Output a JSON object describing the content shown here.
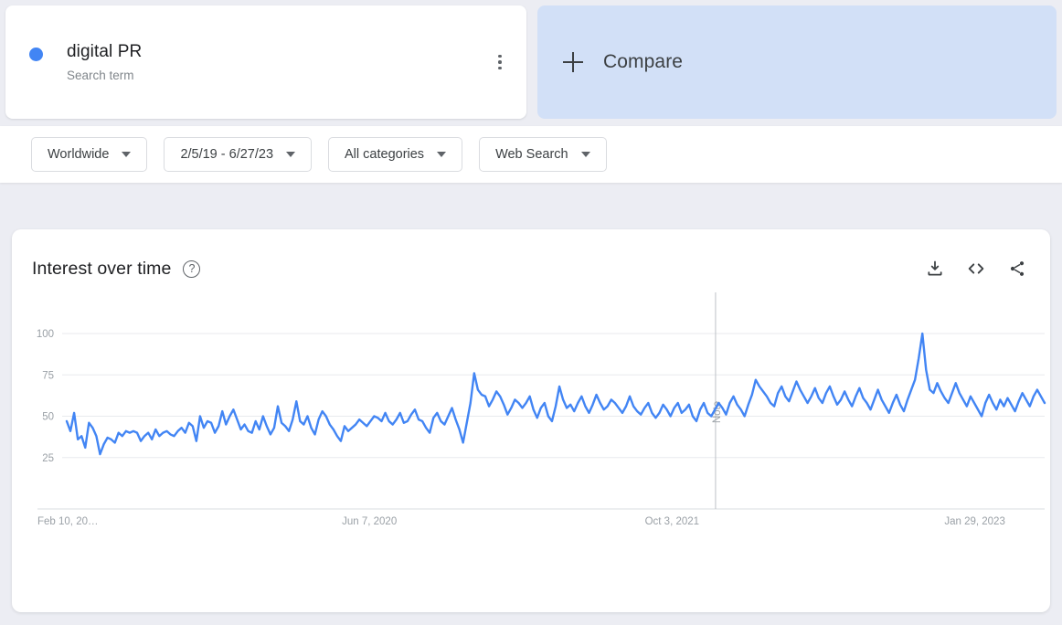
{
  "term": {
    "name": "digital PR",
    "type_label": "Search term",
    "dot_color": "#4285f4",
    "menu_icon": "more-vert-icon"
  },
  "compare": {
    "label": "Compare",
    "icon": "plus-icon"
  },
  "filters": [
    {
      "name": "location",
      "label": "Worldwide"
    },
    {
      "name": "time-range",
      "label": "2/5/19 - 6/27/23"
    },
    {
      "name": "category",
      "label": "All categories"
    },
    {
      "name": "search-type",
      "label": "Web Search"
    }
  ],
  "chart_card": {
    "title": "Interest over time",
    "help_icon": "question-mark-icon",
    "actions": [
      {
        "name": "download-icon",
        "label": "Download"
      },
      {
        "name": "embed-code-icon",
        "label": "Embed"
      },
      {
        "name": "share-icon",
        "label": "Share"
      }
    ]
  },
  "chart_data": {
    "type": "line",
    "title": "Interest over time",
    "xlabel": "",
    "ylabel": "",
    "ylim": [
      0,
      100
    ],
    "yticks": [
      25,
      50,
      75,
      100
    ],
    "grid": true,
    "legend": "none",
    "line_color": "#4285f4",
    "xticks": [
      "Feb 10, 20…",
      "Jun 7, 2020",
      "Oct 3, 2021",
      "Jan 29, 2023"
    ],
    "xtick_positions": [
      0,
      0.3095,
      0.619,
      0.9286
    ],
    "annotations": [
      {
        "label": "Note",
        "x_fraction": 0.6635
      }
    ],
    "series": [
      {
        "name": "digital PR",
        "values": [
          47,
          41,
          52,
          36,
          38,
          31,
          46,
          43,
          38,
          27,
          33,
          37,
          36,
          34,
          40,
          38,
          41,
          40,
          41,
          40,
          35,
          38,
          40,
          36,
          42,
          38,
          40,
          41,
          39,
          38,
          41,
          43,
          40,
          46,
          44,
          35,
          50,
          43,
          47,
          46,
          40,
          44,
          53,
          45,
          50,
          54,
          48,
          42,
          45,
          41,
          40,
          47,
          42,
          50,
          44,
          39,
          43,
          56,
          46,
          44,
          41,
          48,
          59,
          47,
          45,
          50,
          43,
          39,
          48,
          53,
          50,
          45,
          42,
          38,
          35,
          44,
          41,
          43,
          45,
          48,
          46,
          44,
          47,
          50,
          49,
          47,
          52,
          47,
          45,
          48,
          52,
          46,
          47,
          51,
          54,
          48,
          47,
          43,
          40,
          49,
          52,
          47,
          45,
          50,
          55,
          48,
          42,
          34,
          46,
          58,
          76,
          66,
          63,
          62,
          56,
          60,
          65,
          62,
          57,
          51,
          55,
          60,
          58,
          55,
          58,
          62,
          54,
          49,
          55,
          58,
          50,
          47,
          56,
          68,
          60,
          55,
          57,
          53,
          58,
          62,
          56,
          52,
          57,
          63,
          58,
          54,
          56,
          60,
          58,
          55,
          52,
          56,
          62,
          56,
          53,
          51,
          55,
          58,
          52,
          49,
          52,
          57,
          54,
          50,
          55,
          58,
          52,
          54,
          57,
          50,
          47,
          54,
          58,
          52,
          50,
          54,
          58,
          55,
          51,
          58,
          62,
          57,
          54,
          50,
          57,
          63,
          72,
          68,
          65,
          62,
          58,
          56,
          64,
          68,
          62,
          59,
          65,
          71,
          66,
          62,
          58,
          62,
          67,
          61,
          58,
          64,
          68,
          62,
          57,
          60,
          65,
          60,
          56,
          62,
          67,
          61,
          58,
          54,
          60,
          66,
          60,
          56,
          52,
          58,
          63,
          57,
          53,
          60,
          66,
          72,
          85,
          100,
          78,
          66,
          64,
          70,
          65,
          61,
          58,
          64,
          70,
          64,
          60,
          56,
          62,
          58,
          54,
          50,
          58,
          63,
          58,
          54,
          60,
          56,
          61,
          57,
          53,
          59,
          64,
          60,
          56,
          62,
          66,
          62,
          58
        ]
      }
    ]
  }
}
